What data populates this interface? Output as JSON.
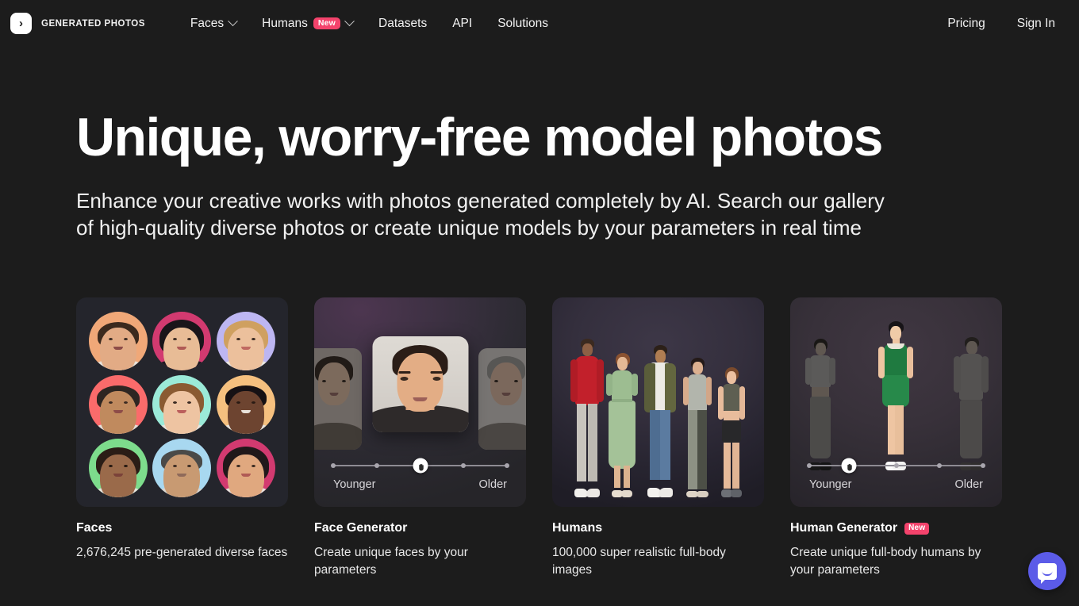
{
  "brand": {
    "logo_icon": "chevron-right-logo-icon",
    "logo_glyph": "›",
    "name": "GENERATED PHOTOS"
  },
  "nav": {
    "main_items": [
      {
        "label": "Faces",
        "has_chevron": true,
        "badge": null
      },
      {
        "label": "Humans",
        "has_chevron": true,
        "badge": "New"
      },
      {
        "label": "Datasets",
        "has_chevron": false,
        "badge": null
      },
      {
        "label": "API",
        "has_chevron": false,
        "badge": null
      },
      {
        "label": "Solutions",
        "has_chevron": false,
        "badge": null
      }
    ],
    "right_items": [
      {
        "label": "Pricing"
      },
      {
        "label": "Sign In"
      }
    ]
  },
  "hero": {
    "headline": "Unique, worry-free model photos",
    "subheadline": "Enhance your creative works with photos generated completely by AI. Search our gallery of high-quality diverse photos or create unique models by your parameters in real time"
  },
  "cards": [
    {
      "id": "faces",
      "title": "Faces",
      "badge": null,
      "description": "2,676,245 pre-generated diverse faces",
      "visual": "avatar-grid-3x3"
    },
    {
      "id": "face-generator",
      "title": "Face Generator",
      "badge": null,
      "description": "Create unique faces by your parameters",
      "visual": "face-carousel-with-age-slider",
      "slider": {
        "left_label": "Younger",
        "right_label": "Older",
        "ticks": 5,
        "handle_position_percent": 50
      }
    },
    {
      "id": "humans",
      "title": "Humans",
      "badge": null,
      "description": "100,000 super realistic full-body images",
      "visual": "five-full-body-models"
    },
    {
      "id": "human-generator",
      "title": "Human Generator",
      "badge": "New",
      "description": "Create unique full-body humans by your parameters",
      "visual": "three-full-body-models-with-age-slider",
      "slider": {
        "left_label": "Younger",
        "right_label": "Older",
        "ticks": 5,
        "handle_position_percent": 23
      }
    }
  ],
  "chat_widget": {
    "icon": "chat-bubble-smile-icon",
    "color": "#5b5be8"
  },
  "colors": {
    "page_background": "#1c1c1c",
    "card_background": "#24252c",
    "accent_pink": "#f4436c",
    "text_primary": "#ffffff",
    "text_secondary": "#e8e8e8",
    "chat_blue": "#5b5be8"
  },
  "avatar_colors": [
    "#f0a878",
    "#d23a70",
    "#bdb6f2",
    "#fa6b6b",
    "#9bead8",
    "#f5c07f",
    "#7ddc8c",
    "#a8d8f0",
    "#d23a70"
  ]
}
